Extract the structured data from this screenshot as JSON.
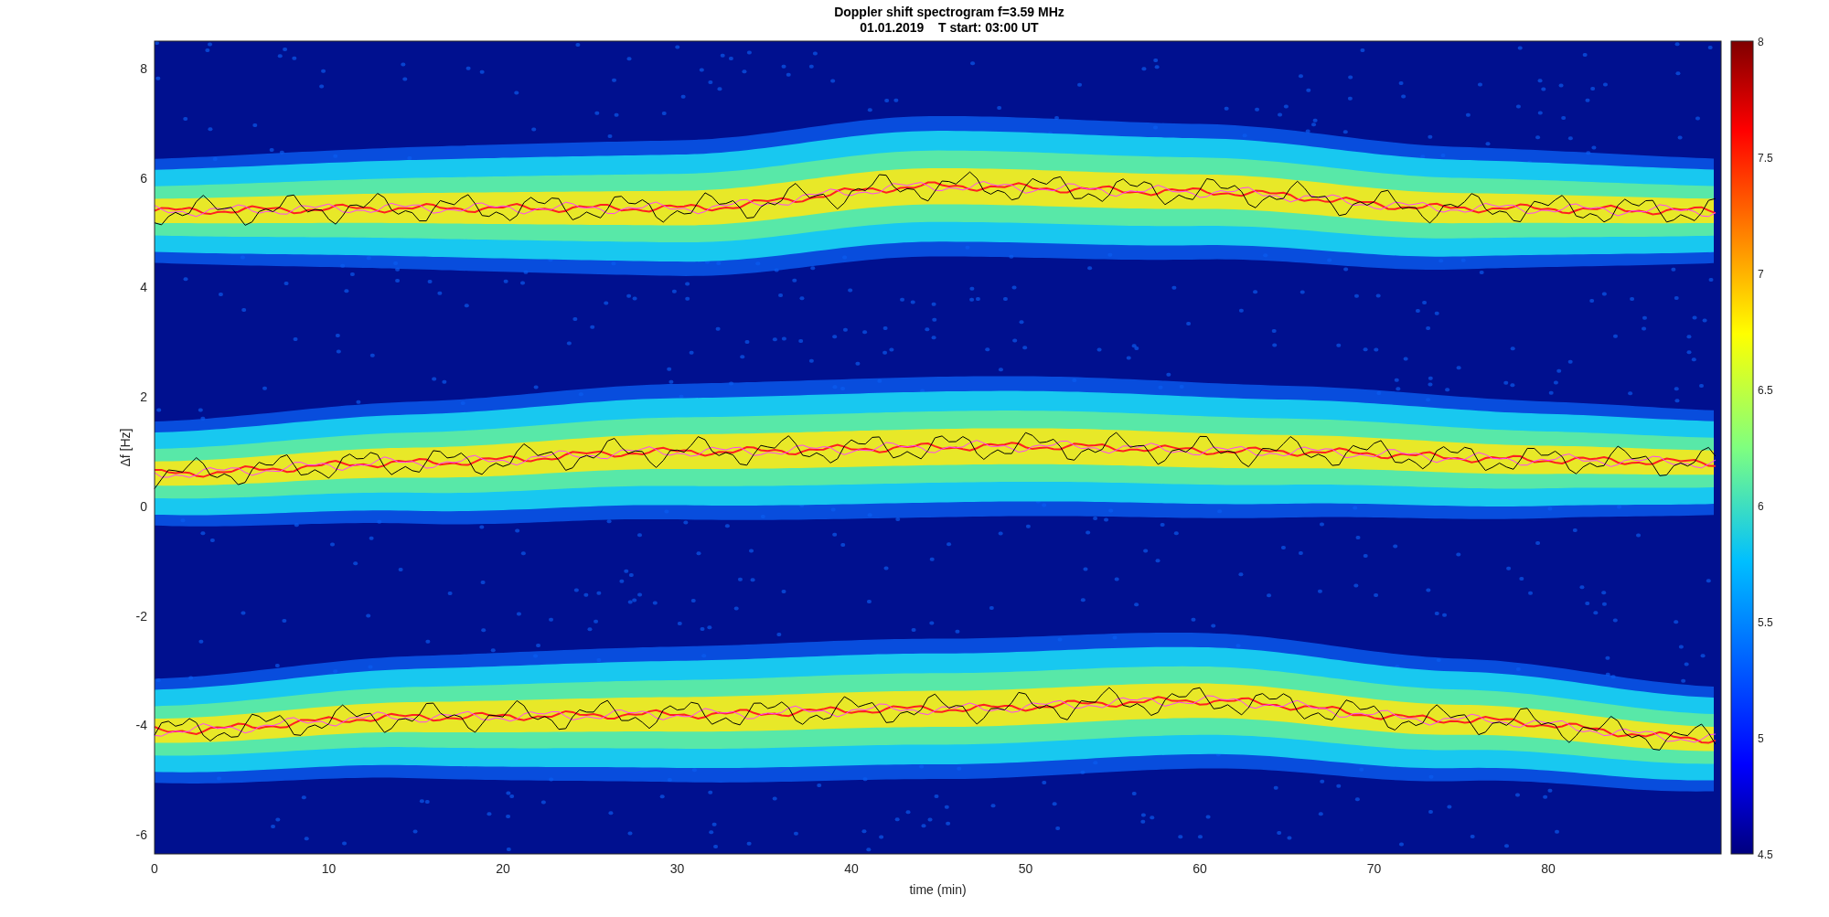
{
  "title": [
    "Doppler shift spectrogram f=3.59 MHz",
    "01.01.2019    T start: 03:00 UT"
  ],
  "y_axis": {
    "label": "Δf [Hz]",
    "ticks": [
      "8",
      "6",
      "4",
      "2",
      "0",
      "-2",
      "-4",
      "-6"
    ]
  },
  "x_axis": {
    "label": "time (min)",
    "ticks": [
      "0",
      "10",
      "20",
      "30",
      "40",
      "50",
      "60",
      "70",
      "80"
    ]
  },
  "colorbar": {
    "ticks": [
      "8",
      "7.5",
      "7",
      "6.5",
      "6",
      "5.5",
      "5",
      "4.5"
    ]
  }
}
